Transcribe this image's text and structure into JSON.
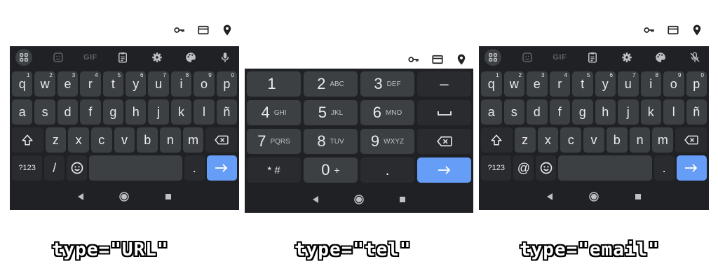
{
  "url_keyboard": {
    "suggestion_gif": "GIF",
    "row1": [
      {
        "label": "q",
        "hint": "1"
      },
      {
        "label": "w",
        "hint": "2"
      },
      {
        "label": "e",
        "hint": "3"
      },
      {
        "label": "r",
        "hint": "4"
      },
      {
        "label": "t",
        "hint": "5"
      },
      {
        "label": "y",
        "hint": "6"
      },
      {
        "label": "u",
        "hint": "7"
      },
      {
        "label": "i",
        "hint": "8"
      },
      {
        "label": "o",
        "hint": "9"
      },
      {
        "label": "p",
        "hint": "0"
      }
    ],
    "row2": [
      "a",
      "s",
      "d",
      "f",
      "g",
      "h",
      "j",
      "k",
      "l",
      "ñ"
    ],
    "row3": [
      "z",
      "x",
      "c",
      "v",
      "b",
      "n",
      "m"
    ],
    "symbols_key": "?123",
    "special_key": "/",
    "period_key": "."
  },
  "tel_keyboard": {
    "rows": [
      [
        {
          "num": "1",
          "letters": ""
        },
        {
          "num": "2",
          "letters": "ABC"
        },
        {
          "num": "3",
          "letters": "DEF"
        }
      ],
      [
        {
          "num": "4",
          "letters": "GHI"
        },
        {
          "num": "5",
          "letters": "JKL"
        },
        {
          "num": "6",
          "letters": "MNO"
        }
      ],
      [
        {
          "num": "7",
          "letters": "PQRS"
        },
        {
          "num": "8",
          "letters": "TUV"
        },
        {
          "num": "9",
          "letters": "WXYZ"
        }
      ]
    ],
    "minus_key": "–",
    "star_hash_key": "* #",
    "zero_key": "0",
    "plus_key": "+",
    "period_key": "."
  },
  "email_keyboard": {
    "suggestion_gif": "GIF",
    "row1": [
      {
        "label": "q",
        "hint": "1"
      },
      {
        "label": "w",
        "hint": "2"
      },
      {
        "label": "e",
        "hint": "3"
      },
      {
        "label": "r",
        "hint": "4"
      },
      {
        "label": "t",
        "hint": "5"
      },
      {
        "label": "y",
        "hint": "6"
      },
      {
        "label": "u",
        "hint": "7"
      },
      {
        "label": "i",
        "hint": "8"
      },
      {
        "label": "o",
        "hint": "9"
      },
      {
        "label": "p",
        "hint": "0"
      }
    ],
    "row2": [
      "a",
      "s",
      "d",
      "f",
      "g",
      "h",
      "j",
      "k",
      "l",
      "ñ"
    ],
    "row3": [
      "z",
      "x",
      "c",
      "v",
      "b",
      "n",
      "m"
    ],
    "symbols_key": "?123",
    "special_key": "@",
    "period_key": "."
  },
  "captions": {
    "url": "type=\"URL\"",
    "tel": "type=\"tel\"",
    "email": "type=\"email\""
  },
  "icons": {
    "status": [
      "key-icon",
      "card-icon",
      "location-pin-icon"
    ],
    "suggestion_bar": [
      "apps-grid-icon",
      "sticker-icon",
      "clipboard-icon",
      "settings-icon",
      "palette-icon",
      "microphone-icon"
    ],
    "navigation": [
      "back-triangle-icon",
      "home-circle-icon",
      "recents-square-icon"
    ]
  },
  "colors": {
    "keyboard_bg": "#202124",
    "key_bg": "#3c4043",
    "key_text": "#e8eaed",
    "enter_key": "#669df6",
    "suggestion_icon": "#5f6368"
  }
}
